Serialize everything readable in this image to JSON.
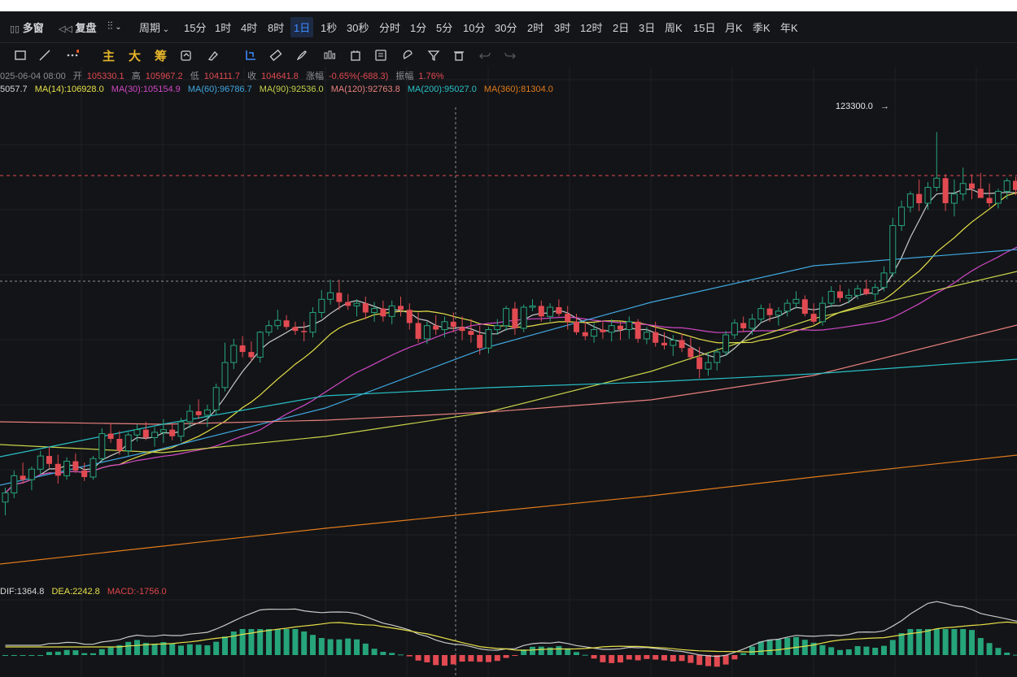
{
  "topbar": {
    "items": [
      {
        "label": "多窗",
        "icon": "layout-icon"
      },
      {
        "label": "复盘",
        "icon": "replay-icon"
      },
      {
        "label": "",
        "icon": "chart-type-icon"
      },
      {
        "label": "周期",
        "icon": "chevron-down-icon"
      },
      {
        "label": "15分"
      },
      {
        "label": "1时"
      },
      {
        "label": "4时"
      },
      {
        "label": "8时"
      },
      {
        "label": "1日",
        "active": true
      },
      {
        "label": "1秒"
      },
      {
        "label": "30秒"
      },
      {
        "label": "分时"
      },
      {
        "label": "1分"
      },
      {
        "label": "5分"
      },
      {
        "label": "10分"
      },
      {
        "label": "30分"
      },
      {
        "label": "2时"
      },
      {
        "label": "3时"
      },
      {
        "label": "12时"
      },
      {
        "label": "2日"
      },
      {
        "label": "3日"
      },
      {
        "label": "周K"
      },
      {
        "label": "15日"
      },
      {
        "label": "月K"
      },
      {
        "label": "季K"
      },
      {
        "label": "年K"
      }
    ]
  },
  "toolbar": {
    "indicator_labels": [
      "主",
      "大",
      "筹"
    ],
    "icons": [
      "rectangle-icon",
      "line-icon",
      "more-icon",
      "sync-icon",
      "clear-icon",
      "crosshair-icon",
      "ruler-icon",
      "brush-icon",
      "candles-icon",
      "calendar-icon",
      "notes-icon",
      "magnet-icon",
      "filter-icon",
      "trash-icon",
      "undo-icon",
      "redo-icon"
    ]
  },
  "ohlc": {
    "date": "025-06-04 08:00",
    "open_label": "开",
    "open": "105330.1",
    "high_label": "高",
    "high": "105967.2",
    "low_label": "低",
    "low": "104111.7",
    "close_label": "收",
    "close": "104641.8",
    "change_label": "涨幅",
    "change": "-0.65%(-688.3)",
    "amp_label": "振幅",
    "amp": "1.76%"
  },
  "ma": [
    {
      "label": "5057.7",
      "color": "#d7d7d7"
    },
    {
      "label": "MA(14):106928.0",
      "color": "#e6e04a"
    },
    {
      "label": "MA(30):105154.9",
      "color": "#d048c6"
    },
    {
      "label": "MA(60):96786.7",
      "color": "#3fa7e0"
    },
    {
      "label": "MA(90):92536.0",
      "color": "#c8d24a"
    },
    {
      "label": "MA(120):92763.8",
      "color": "#e8807e"
    },
    {
      "label": "MA(200):95027.0",
      "color": "#27c1c7"
    },
    {
      "label": "MA(360):81304.0",
      "color": "#e07b1c"
    }
  ],
  "max_label": "123300.0",
  "macd": {
    "dif": "DIF:1364.8",
    "dea": "DEA:2242.8",
    "macd": "MACD:-1756.0",
    "dif_color": "#d7d7d7",
    "dea_color": "#e6e04a",
    "macd_color": "#e0464b"
  },
  "colors": {
    "up": "#26a47a",
    "down": "#e24a52",
    "bg": "#131417"
  },
  "chart_data": {
    "type": "candlestick",
    "candles": [
      [
        95200,
        96300,
        94200,
        95900
      ],
      [
        95900,
        97600,
        95500,
        97200
      ],
      [
        97200,
        98200,
        96600,
        96900
      ],
      [
        96900,
        97900,
        96100,
        97700
      ],
      [
        97700,
        99100,
        97300,
        98700
      ],
      [
        98700,
        99400,
        97800,
        98100
      ],
      [
        98100,
        98800,
        96600,
        97200
      ],
      [
        97200,
        98600,
        96900,
        98300
      ],
      [
        98300,
        98900,
        97400,
        97600
      ],
      [
        97600,
        98200,
        96800,
        97100
      ],
      [
        97100,
        98700,
        96900,
        98500
      ],
      [
        98500,
        100800,
        98200,
        100400
      ],
      [
        100400,
        101200,
        99700,
        100000
      ],
      [
        100000,
        100600,
        98800,
        99100
      ],
      [
        99100,
        100500,
        98700,
        100300
      ],
      [
        100300,
        101100,
        99800,
        100700
      ],
      [
        100700,
        101300,
        99900,
        100100
      ],
      [
        100100,
        100900,
        99400,
        100500
      ],
      [
        100500,
        101500,
        99700,
        100700
      ],
      [
        100700,
        101200,
        99900,
        100200
      ],
      [
        100200,
        101600,
        99800,
        101300
      ],
      [
        101300,
        102600,
        100800,
        102100
      ],
      [
        102100,
        103000,
        101500,
        101800
      ],
      [
        101800,
        102600,
        100900,
        102200
      ],
      [
        102200,
        104200,
        101800,
        103900
      ],
      [
        103900,
        107300,
        103600,
        105800
      ],
      [
        105800,
        107600,
        105300,
        107100
      ],
      [
        107100,
        107800,
        106200,
        106600
      ],
      [
        106600,
        107400,
        105900,
        106200
      ],
      [
        106200,
        108200,
        105800,
        108100
      ],
      [
        108100,
        109000,
        107800,
        108600
      ],
      [
        108600,
        109800,
        108300,
        109000
      ],
      [
        109000,
        109400,
        108300,
        108500
      ],
      [
        108500,
        108900,
        107900,
        108200
      ],
      [
        108200,
        108900,
        107400,
        108100
      ],
      [
        108100,
        110000,
        107700,
        109600
      ],
      [
        109600,
        111300,
        109200,
        110600
      ],
      [
        110600,
        112100,
        110200,
        111100
      ],
      [
        111100,
        112100,
        109800,
        110400
      ],
      [
        110400,
        111000,
        109800,
        110100
      ],
      [
        110100,
        110600,
        109300,
        110300
      ],
      [
        110300,
        110800,
        109100,
        109600
      ],
      [
        109600,
        110400,
        108900,
        109900
      ],
      [
        109900,
        110500,
        108900,
        109300
      ],
      [
        109300,
        110500,
        108700,
        110100
      ],
      [
        110100,
        110800,
        109300,
        109800
      ],
      [
        109800,
        110300,
        108300,
        108800
      ],
      [
        108800,
        109600,
        107300,
        107600
      ],
      [
        107600,
        108900,
        107200,
        108600
      ],
      [
        108600,
        109400,
        107900,
        108300
      ],
      [
        108300,
        109300,
        107700,
        108900
      ],
      [
        108900,
        109600,
        108100,
        108500
      ],
      [
        108500,
        109300,
        107500,
        108200
      ],
      [
        108200,
        109100,
        107300,
        107900
      ],
      [
        107900,
        108600,
        106400,
        106900
      ],
      [
        106900,
        108500,
        106500,
        108300
      ],
      [
        108300,
        109100,
        107900,
        108600
      ],
      [
        108600,
        110100,
        108200,
        109900
      ],
      [
        109900,
        110400,
        107900,
        108400
      ],
      [
        108400,
        110200,
        108100,
        110000
      ],
      [
        110000,
        110600,
        109700,
        110100
      ],
      [
        110100,
        110500,
        108900,
        109300
      ],
      [
        109300,
        110300,
        108900,
        110000
      ],
      [
        110000,
        110600,
        109300,
        109500
      ],
      [
        109500,
        110100,
        108300,
        108900
      ],
      [
        108900,
        109500,
        107900,
        108100
      ],
      [
        108100,
        108900,
        107500,
        107800
      ],
      [
        107800,
        108800,
        107300,
        108300
      ],
      [
        108300,
        108900,
        107600,
        108100
      ],
      [
        108100,
        109100,
        107400,
        108600
      ],
      [
        108600,
        108900,
        107500,
        108300
      ],
      [
        108300,
        109300,
        107600,
        108900
      ],
      [
        108900,
        109100,
        107300,
        107600
      ],
      [
        107600,
        108500,
        107200,
        108100
      ],
      [
        108100,
        108900,
        107000,
        107300
      ],
      [
        107300,
        108100,
        106800,
        107100
      ],
      [
        107100,
        107900,
        106300,
        107500
      ],
      [
        107500,
        108000,
        106600,
        106900
      ],
      [
        106900,
        107700,
        106000,
        106200
      ],
      [
        106200,
        107000,
        104600,
        105300
      ],
      [
        105300,
        106600,
        104800,
        105800
      ],
      [
        105800,
        106900,
        105200,
        106600
      ],
      [
        106600,
        108200,
        106300,
        107900
      ],
      [
        107900,
        109100,
        107600,
        108800
      ],
      [
        108800,
        109300,
        108100,
        108400
      ],
      [
        108400,
        109500,
        107900,
        109100
      ],
      [
        109100,
        110200,
        108800,
        109900
      ],
      [
        109900,
        110300,
        108900,
        109400
      ],
      [
        109400,
        110000,
        108600,
        109700
      ],
      [
        109700,
        110600,
        109300,
        110300
      ],
      [
        110300,
        111200,
        109900,
        110600
      ],
      [
        110600,
        110900,
        109300,
        109500
      ],
      [
        109500,
        110300,
        108700,
        108900
      ],
      [
        108900,
        110800,
        108600,
        110300
      ],
      [
        110300,
        111600,
        110000,
        111200
      ],
      [
        111200,
        111700,
        110400,
        110700
      ],
      [
        110700,
        111400,
        110300,
        110900
      ],
      [
        110900,
        111700,
        110600,
        111400
      ],
      [
        111400,
        112100,
        110900,
        111000
      ],
      [
        111000,
        111800,
        110500,
        111500
      ],
      [
        111500,
        113100,
        111200,
        112600
      ],
      [
        112600,
        116800,
        112300,
        116200
      ],
      [
        116200,
        118100,
        115800,
        117600
      ],
      [
        117600,
        118800,
        117200,
        118600
      ],
      [
        118600,
        119700,
        117300,
        117900
      ],
      [
        117900,
        119500,
        117400,
        119100
      ],
      [
        119100,
        123300,
        118800,
        119800
      ],
      [
        119800,
        120100,
        117300,
        117900
      ],
      [
        117900,
        119700,
        116900,
        118600
      ],
      [
        118600,
        120600,
        118100,
        119400
      ],
      [
        119400,
        120100,
        118200,
        119000
      ],
      [
        119000,
        120200,
        118500,
        118300
      ],
      [
        118300,
        119400,
        117600,
        117900
      ],
      [
        117900,
        119000,
        117500,
        118800
      ],
      [
        118800,
        119800,
        118200,
        119600
      ],
      [
        119600,
        119900,
        118500,
        118900
      ],
      [
        118900,
        119300,
        117800,
        118400
      ],
      [
        118400,
        119100,
        116900,
        117700
      ]
    ],
    "ma_series": [
      "MA(14)",
      "MA(30)",
      "MA(60)",
      "MA(90)",
      "MA(120)",
      "MA(200)",
      "MA(360)"
    ],
    "max_marker": 123300.0
  }
}
